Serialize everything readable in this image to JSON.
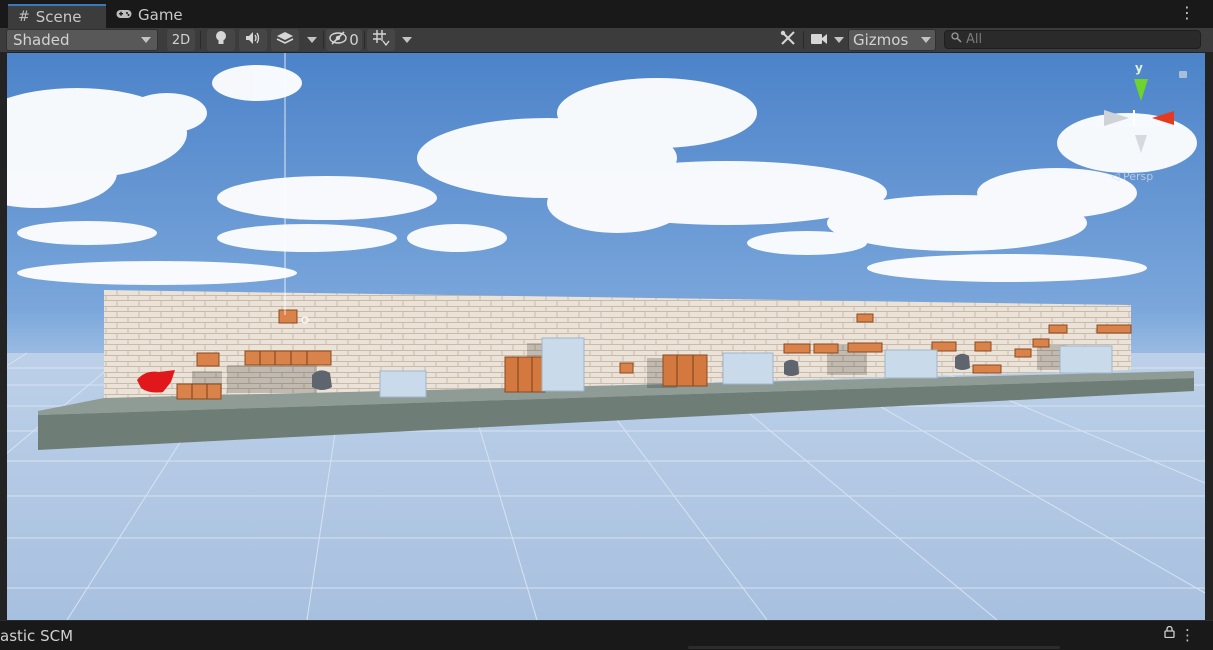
{
  "tabs": [
    {
      "label": "Scene",
      "icon": "grid-icon",
      "active": true
    },
    {
      "label": "Game",
      "icon": "gamepad-icon",
      "active": false
    }
  ],
  "toolbar": {
    "shading_mode": "Shaded",
    "toggle_2d": "2D",
    "hidden_count": "0",
    "gizmos_label": "Gizmos",
    "search_placeholder": "All",
    "icons": [
      "lightbulb-icon",
      "audio-icon",
      "effects-icon",
      "visibility-icon",
      "grid-snap-icon",
      "tools-icon",
      "camera-icon",
      "search-icon"
    ]
  },
  "gizmo": {
    "y_label": "y",
    "projection": "Persp"
  },
  "status": {
    "label": "astic SCM"
  },
  "colors": {
    "tab_accent": "#3a79bb",
    "sky": "#6d9ad3",
    "wall": "#e6dcd0",
    "ground": "#7e8d86",
    "player": "#e0171b"
  }
}
